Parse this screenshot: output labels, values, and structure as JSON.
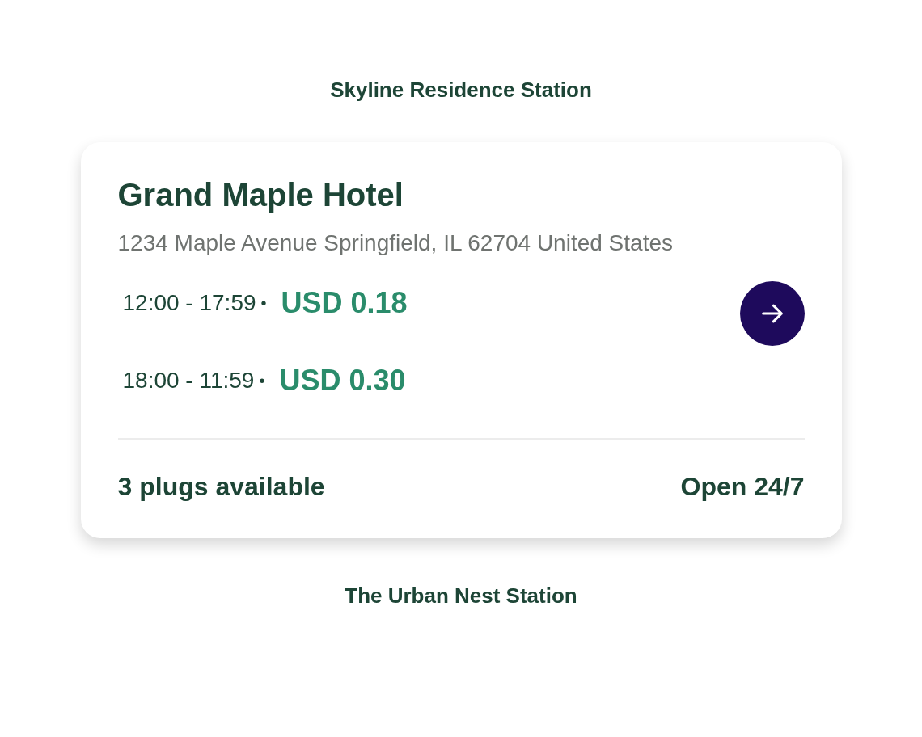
{
  "top_station": {
    "name": "Skyline Residence Station"
  },
  "card": {
    "title": "Grand Maple Hotel",
    "address": "1234 Maple Avenue Springfield, IL 62704 United States",
    "rates": [
      {
        "time": "12:00 - 17:59",
        "separator": "•",
        "price": "USD 0.18"
      },
      {
        "time": "18:00 - 11:59",
        "separator": "•",
        "price": "USD 0.30"
      }
    ],
    "plugs": "3 plugs available",
    "hours": "Open 24/7"
  },
  "bottom_station": {
    "name": "The Urban Nest Station"
  }
}
